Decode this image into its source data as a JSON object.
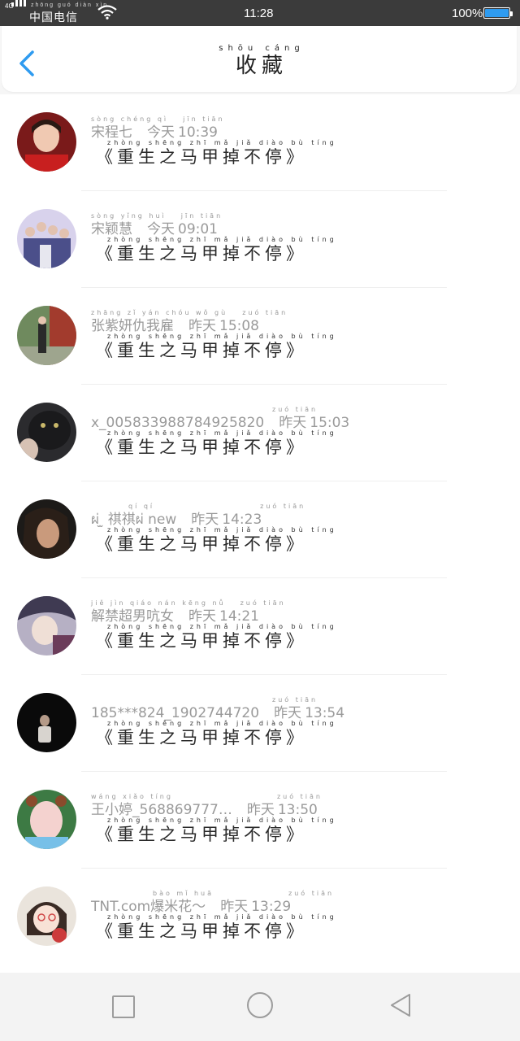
{
  "status_bar": {
    "network": "4G",
    "carrier_pinyin": "zhōng guó diàn xìn",
    "carrier": "中国电信",
    "time": "11:28",
    "battery": "100%"
  },
  "header": {
    "title_pinyin": "shōu cáng",
    "title": "收藏"
  },
  "items": [
    {
      "name_pinyin": "sòng chéng qì",
      "name": "宋程七",
      "day_pinyin": "jīn tiān",
      "day": "今天",
      "time": "10:39",
      "content_pinyin": "zhòng shēng zhī mǎ jiǎ diào bù tíng",
      "content": "《重生之马甲掉不停》"
    },
    {
      "name_pinyin": "sòng yǐng huì",
      "name": "宋颖慧",
      "day_pinyin": "jīn tiān",
      "day": "今天",
      "time": "09:01",
      "content_pinyin": "zhòng shēng zhī mǎ jiǎ diào bù tíng",
      "content": "《重生之马甲掉不停》"
    },
    {
      "name_pinyin": "zhāng zǐ yán chóu wǒ gù",
      "name": "张紫妍仇我雇",
      "day_pinyin": "zuó tiān",
      "day": "昨天",
      "time": "15:08",
      "content_pinyin": "zhòng shēng zhī mǎ jiǎ diào bù tíng",
      "content": "《重生之马甲掉不停》"
    },
    {
      "name_pinyin": "",
      "name": "x_005833988784925820",
      "day_pinyin": "zuó tiān",
      "day": "昨天",
      "time": "15:03",
      "content_pinyin": "zhòng shēng zhī mǎ jiǎ diào bù tíng",
      "content": "《重生之马甲掉不停》"
    },
    {
      "name_pinyin": "qí qí",
      "name": "ผ่ ̫ 祺祺ผ่ new",
      "day_pinyin": "zuó tiān",
      "day": "昨天",
      "time": "14:23",
      "content_pinyin": "zhòng shēng zhī mǎ jiǎ diào bù tíng",
      "content": "《重生之马甲掉不停》"
    },
    {
      "name_pinyin": "jiě jìn qiáo nán kēng nǚ",
      "name": "解禁超男吭女",
      "day_pinyin": "zuó tiān",
      "day": "昨天",
      "time": "14:21",
      "content_pinyin": "zhòng shēng zhī mǎ jiǎ diào bù tíng",
      "content": "《重生之马甲掉不停》"
    },
    {
      "name_pinyin": "",
      "name": "185***824_1902744720",
      "day_pinyin": "zuó tiān",
      "day": "昨天",
      "time": "13:54",
      "content_pinyin": "zhòng shēng zhī mǎ jiǎ diào bù tíng",
      "content": "《重生之马甲掉不停》"
    },
    {
      "name_pinyin": "wáng xiǎo tíng",
      "name": "王小婷_568869777…",
      "day_pinyin": "zuó tiān",
      "day": "昨天",
      "time": "13:50",
      "content_pinyin": "zhòng shēng zhī mǎ jiǎ diào bù tíng",
      "content": "《重生之马甲掉不停》"
    },
    {
      "name_pinyin": "bào mǐ huā",
      "name": "TNT.com爆米花～",
      "day_pinyin": "zuó tiān",
      "day": "昨天",
      "time": "13:29",
      "content_pinyin": "zhòng shēng zhī mǎ jiǎ diào bù tíng",
      "content": "《重生之马甲掉不停》"
    }
  ],
  "nav": {
    "recent_icon": "square-icon",
    "home_icon": "circle-icon",
    "back_icon": "triangle-back-icon"
  },
  "colors": {
    "accent": "#2e9bf0",
    "status_bar": "#3b3b3b",
    "meta_text": "#9a9a9a",
    "content_text": "#2a2a2a"
  }
}
